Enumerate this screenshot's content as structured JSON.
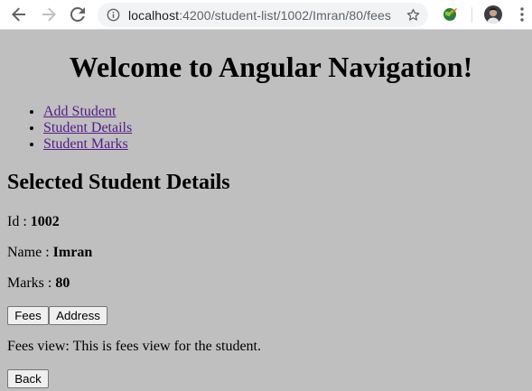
{
  "browser": {
    "url_host": "localhost",
    "url_path": ":4200/student-list/1002/Imran/80/fees"
  },
  "page": {
    "title": "Welcome to Angular Navigation!",
    "nav": [
      {
        "label": "Add Student"
      },
      {
        "label": "Student Details"
      },
      {
        "label": "Student Marks"
      }
    ],
    "section_title": "Selected Student Details",
    "fields": {
      "id_label": "Id : ",
      "id_value": "1002",
      "name_label": "Name : ",
      "name_value": "Imran",
      "marks_label": "Marks : ",
      "marks_value": "80"
    },
    "buttons": {
      "fees": "Fees",
      "address": "Address",
      "back": "Back"
    },
    "fees_view": "Fees view: This is fees view for the student."
  },
  "colors": {
    "page_background": "#bfbfbf",
    "visited_link": "#551a8b"
  }
}
